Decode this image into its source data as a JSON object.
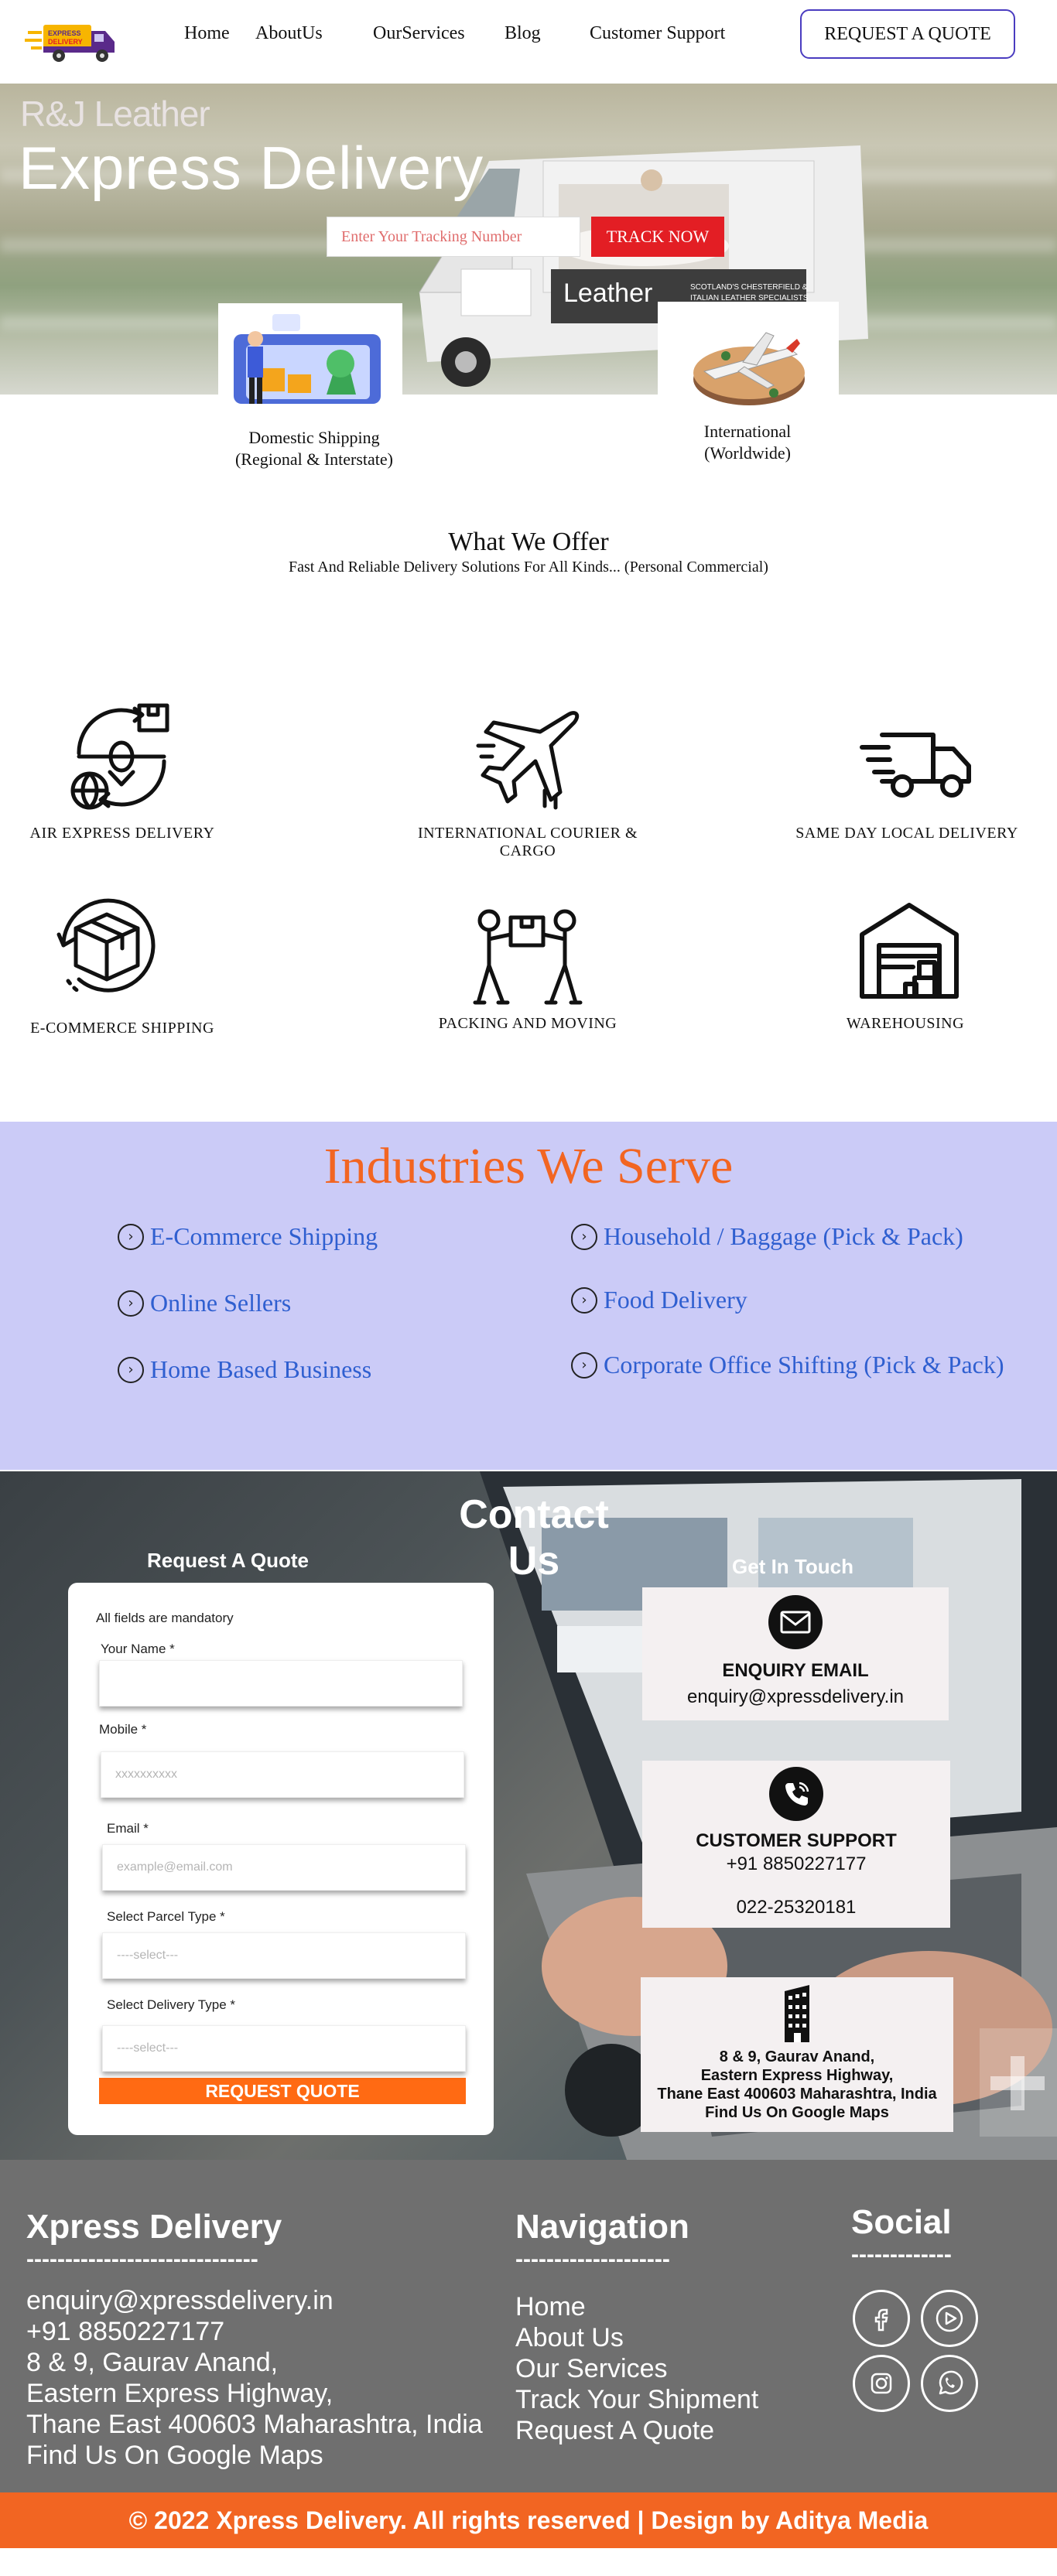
{
  "header": {
    "logo_text": "EXPRESS DELIVERY",
    "nav": [
      "Home",
      "AboutUs",
      "OurServices",
      "Blog",
      "Customer Support"
    ],
    "quote_button": "REQUEST A QUOTE"
  },
  "hero": {
    "brand": "R&J Leather",
    "title": "Express Delivery",
    "tracking_placeholder": "Enter Your Tracking Number",
    "track_button": "TRACK NOW"
  },
  "shipping": [
    {
      "line1": "Domestic Shipping",
      "line2": "(Regional & Interstate)"
    },
    {
      "line1": "International",
      "line2": "(Worldwide)"
    }
  ],
  "offer": {
    "title": "What We Offer",
    "subtitle": "Fast And Reliable Delivery Solutions For All Kinds... (Personal Commercial)"
  },
  "services": [
    {
      "label": "AIR EXPRESS DELIVERY",
      "icon": "air-express-icon"
    },
    {
      "label": "INTERNATIONAL COURIER & CARGO",
      "icon": "airplane-icon"
    },
    {
      "label": "SAME DAY LOCAL DELIVERY",
      "icon": "fast-truck-icon"
    },
    {
      "label": "E-COMMERCE SHIPPING",
      "icon": "box-return-icon"
    },
    {
      "label": "PACKING AND MOVING",
      "icon": "movers-icon"
    },
    {
      "label": "WAREHOUSING",
      "icon": "warehouse-icon"
    }
  ],
  "industries": {
    "title": "Industries We Serve",
    "items": [
      "E-Commerce Shipping",
      "Online Sellers",
      "Home Based Business",
      "Household / Baggage (Pick & Pack)",
      "Food Delivery",
      "Corporate Office Shifting (Pick & Pack)"
    ]
  },
  "contact": {
    "title": "Contact Us",
    "request_title": "Request A Quote",
    "touch_title": "Get In Touch",
    "form": {
      "note": "All fields are mandatory",
      "name_label": "Your Name *",
      "name_value": "",
      "mobile_label": "Mobile *",
      "mobile_placeholder": "xxxxxxxxxx",
      "email_label": "Email *",
      "email_placeholder": "example@email.com",
      "parcel_label": "Select Parcel Type *",
      "parcel_value": "----select---",
      "delivery_label": "Select Delivery Type *",
      "delivery_value": "----select---",
      "submit": "REQUEST QUOTE"
    },
    "email_box": {
      "heading": "ENQUIRY EMAIL",
      "value": "enquiry@xpressdelivery.in"
    },
    "support_box": {
      "heading": "CUSTOMER SUPPORT",
      "phone1": "+91 8850227177",
      "phone2": "022-25320181"
    },
    "address_box": {
      "line1": "8 & 9, Gaurav Anand,",
      "line2": "Eastern Express Highway,",
      "line3": "Thane East 400603 Maharashtra, India",
      "line4": "Find Us On Google Maps"
    }
  },
  "footer": {
    "brand_heading": "Xpress Delivery",
    "brand_dashes": "------------------------------",
    "contact_lines": [
      "enquiry@xpressdelivery.in",
      "+91 8850227177",
      "8 & 9, Gaurav Anand,",
      "Eastern Express Highway,",
      "Thane East 400603 Maharashtra, India",
      "Find Us On Google Maps"
    ],
    "nav_heading": "Navigation",
    "nav_dashes": "--------------------",
    "nav_links": [
      "Home",
      "About Us",
      "Our Services",
      "Track Your Shipment",
      "Request A Quote"
    ],
    "social_heading": "Social",
    "social_dashes": "-------------",
    "social_icons": [
      "facebook-icon",
      "youtube-icon",
      "instagram-icon",
      "whatsapp-icon"
    ],
    "copyright": "© 2022 Xpress Delivery. All rights reserved | Design by Aditya Media"
  },
  "colors": {
    "accent_orange": "#f26522",
    "track_red": "#e31e24",
    "industries_bg": "#cbcbf7",
    "industry_link": "#2f5fd0",
    "footer_bg": "#6f6f6f"
  }
}
